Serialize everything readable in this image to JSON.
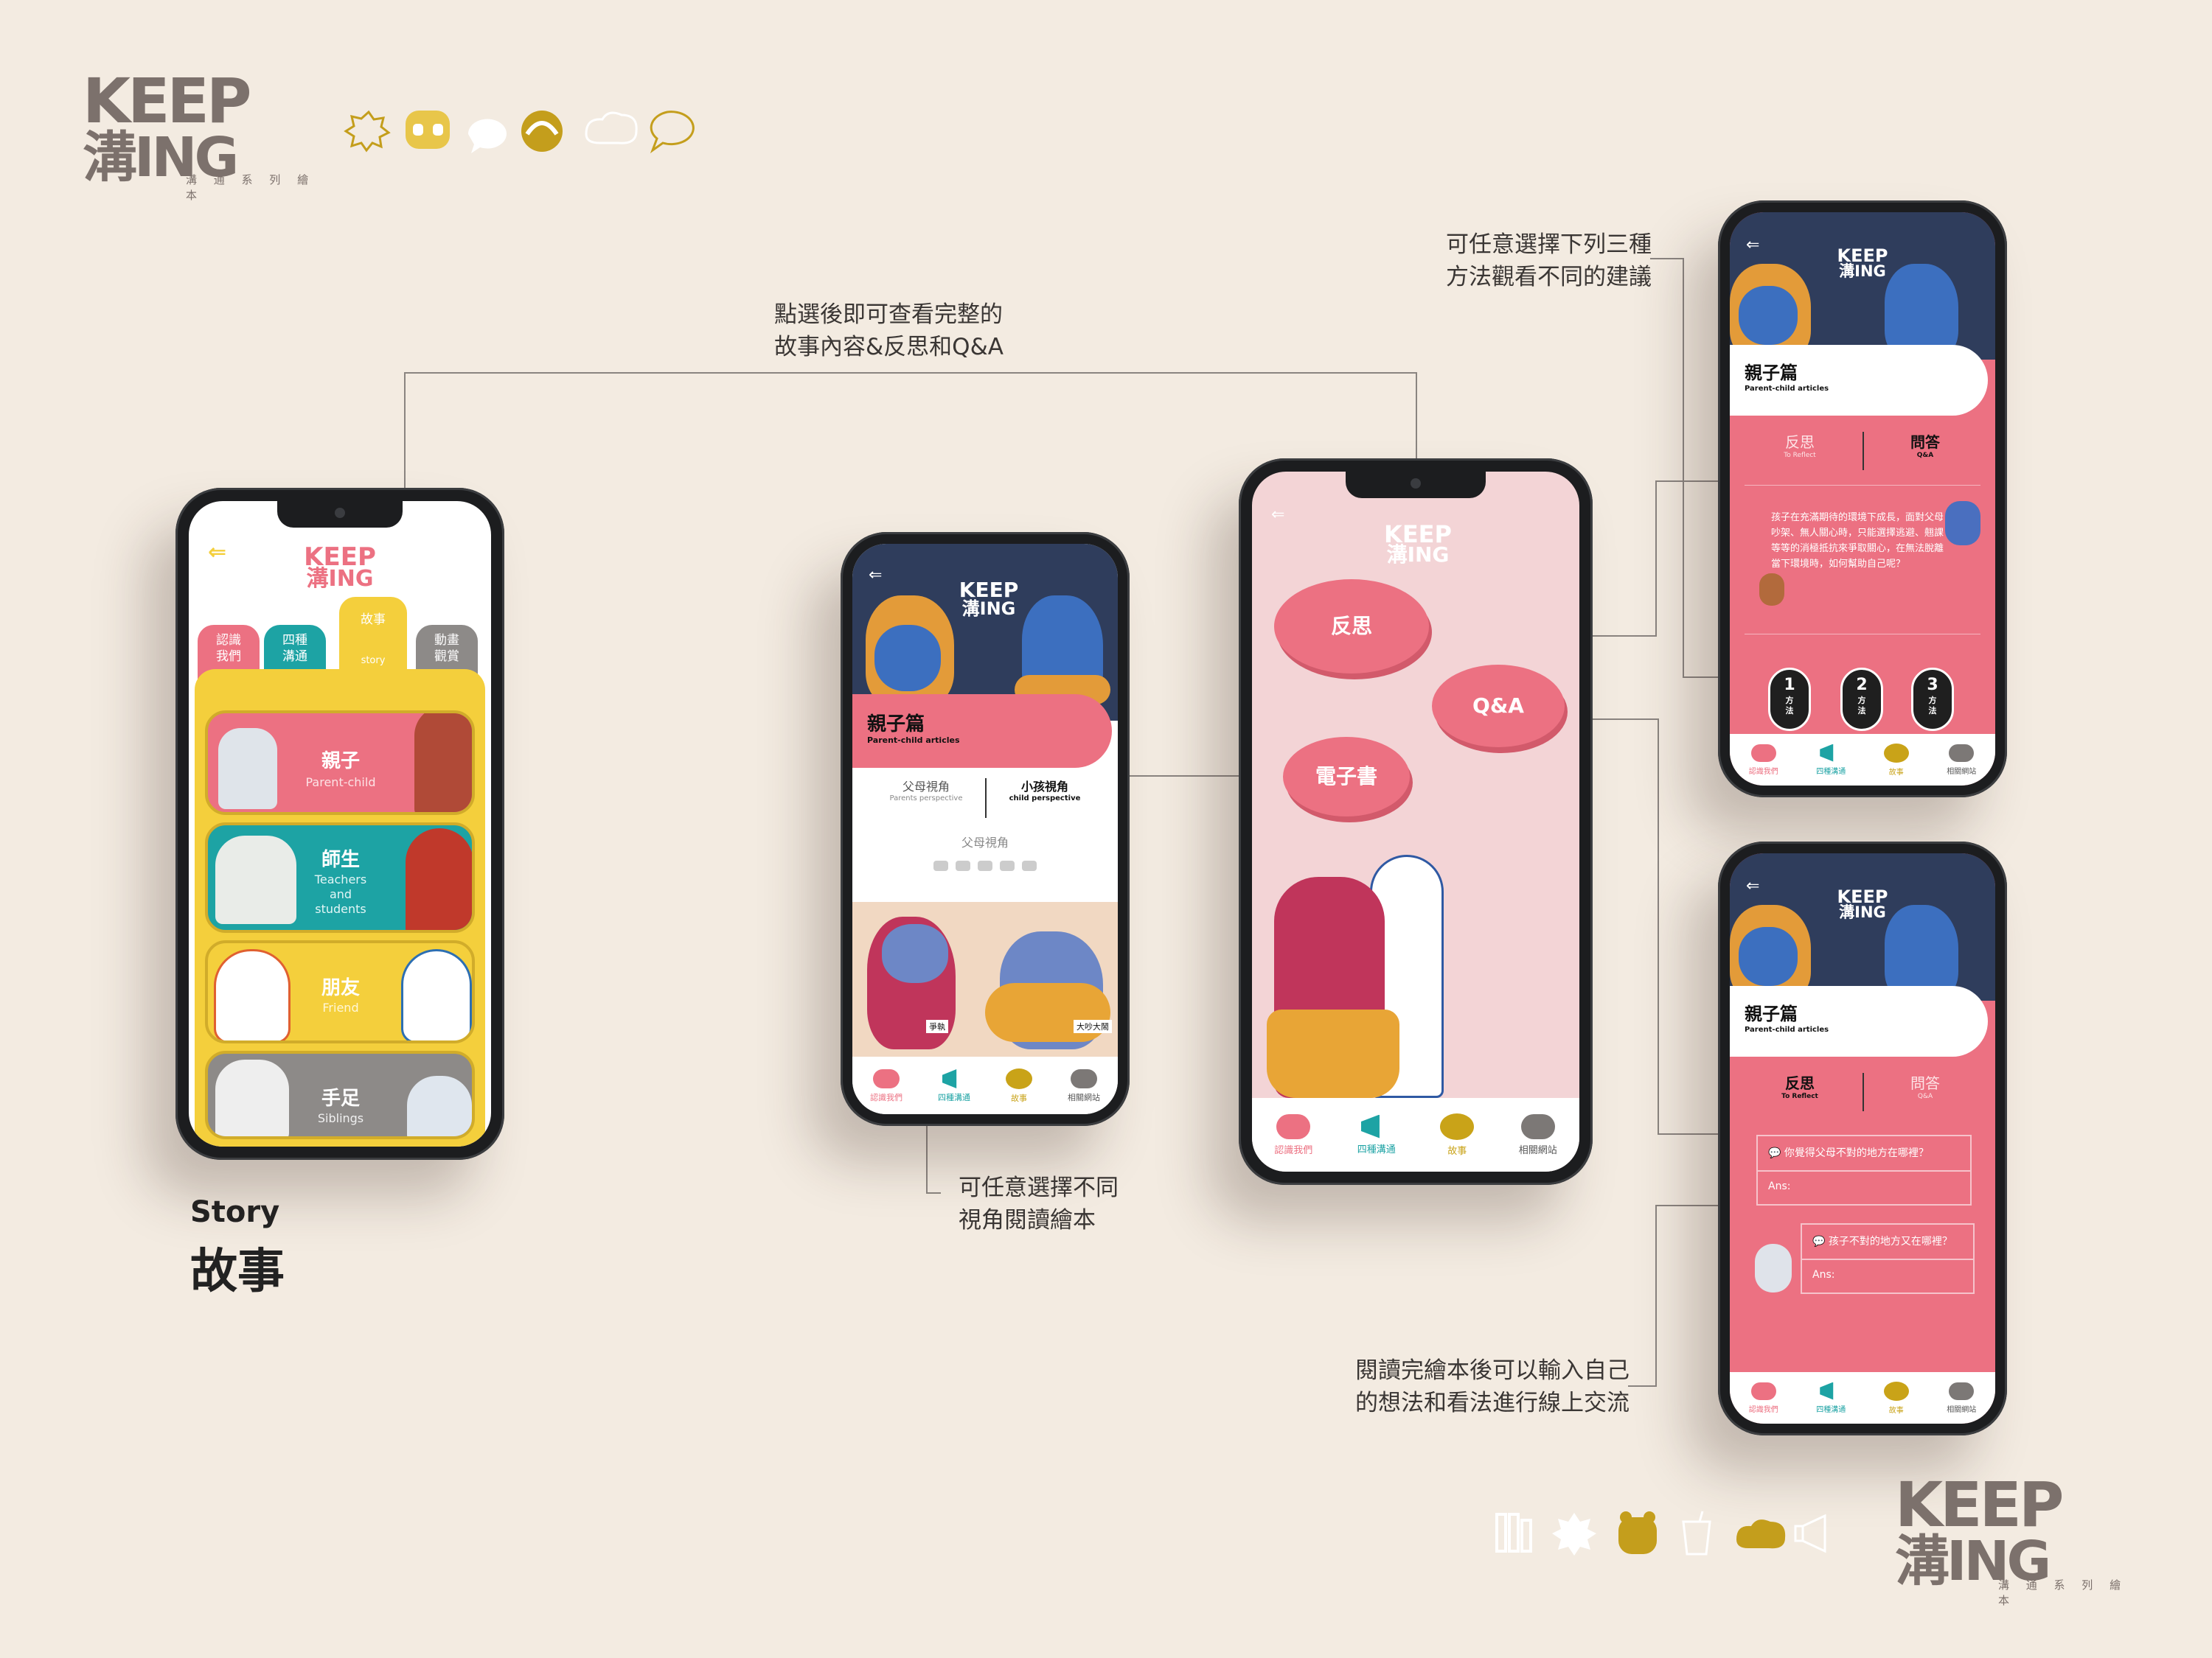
{
  "brand": {
    "logo_top": "KEEP",
    "logo_bottom": "溝ING",
    "subtitle": "溝 通 系 列 繪 本"
  },
  "colors": {
    "background": "#f3ebe1",
    "pink": "#ec7182",
    "teal": "#1da3a4",
    "yellow": "#f4cf3c",
    "gray": "#8d8a88",
    "navy": "#2f3d5c"
  },
  "top_icons": [
    "sun-burst-icon",
    "bear-face-icon",
    "speech-bubble-icon",
    "swirl-icon",
    "cloud-icon",
    "chat-bubble-icon"
  ],
  "bottom_icons": [
    "books-icon",
    "spiky-bubble-icon",
    "bear-icon",
    "cup-icon",
    "cloud-icon",
    "megaphone-icon"
  ],
  "section": {
    "title_en": "Story",
    "title_zh": "故事"
  },
  "annotations": {
    "top_center": [
      "點選後即可查看完整的",
      "故事內容&反思和Q&A"
    ],
    "top_right": [
      "可任意選擇下列三種",
      "方法觀看不同的建議"
    ],
    "mid_center": [
      "可任意選擇不同",
      "視角閱讀繪本"
    ],
    "bottom_right": [
      "閱讀完繪本後可以輸入自己",
      "的想法和看法進行線上交流"
    ]
  },
  "phone1": {
    "tabs": [
      {
        "label": "認識\n我們",
        "color": "#ec7182"
      },
      {
        "label": "四種\n溝通",
        "color": "#1da3a4"
      },
      {
        "label": "故事",
        "sub": "story",
        "color": "#f4cf3c"
      },
      {
        "label": "動畫\n觀賞",
        "color": "#8d8a88"
      }
    ],
    "cards": [
      {
        "zh": "親子",
        "en": "Parent-child",
        "color": "#ec7182"
      },
      {
        "zh": "師生",
        "en": "Teachers\nand\nstudents",
        "color": "#1da3a4"
      },
      {
        "zh": "朋友",
        "en": "Friend",
        "color": "#f4cf3c"
      },
      {
        "zh": "手足",
        "en": "Siblings",
        "color": "#8d8a88"
      }
    ]
  },
  "phone2": {
    "title_zh": "親子篇",
    "title_en": "Parent-child articles",
    "view_left_zh": "父母視角",
    "view_left_en": "Parents perspective",
    "view_right_zh": "小孩視角",
    "view_right_en": "child perspective",
    "current_view": "父母視角",
    "speech_labels": [
      "爭執",
      "大吵大鬧"
    ]
  },
  "phone3": {
    "bubbles": [
      "反思",
      "Q&A",
      "電子書"
    ]
  },
  "phone4": {
    "title_zh": "親子篇",
    "title_en": "Parent-child articles",
    "tab_left_zh": "反思",
    "tab_left_en": "To Reflect",
    "tab_right_zh": "問答",
    "tab_right_en": "Q&A",
    "body": "孩子在充滿期待的環境下成長，面對父母吵架、無人關心時，只能選擇逃避、翹課等等的消極抵抗來爭取關心，在無法脫離當下環境時，如何幫助自己呢？",
    "methods": [
      {
        "num": "1",
        "label": "方法"
      },
      {
        "num": "2",
        "label": "方法"
      },
      {
        "num": "3",
        "label": "方法"
      }
    ]
  },
  "phone5": {
    "title_zh": "親子篇",
    "title_en": "Parent-child articles",
    "tab_left_zh": "反思",
    "tab_left_en": "To Reflect",
    "tab_right_zh": "問答",
    "tab_right_en": "Q&A",
    "q1": "你覺得父母不對的地方在哪裡？",
    "a1": "Ans:",
    "q2": "孩子不對的地方又在哪裡？",
    "a2": "Ans:"
  },
  "nav": [
    {
      "label": "認識我們",
      "icon": "cloud-icon",
      "color": "#ec7182"
    },
    {
      "label": "四種溝通",
      "icon": "megaphone-icon",
      "color": "#1da3a4"
    },
    {
      "label": "故事",
      "icon": "speech-bubble-icon",
      "color": "#c9a318"
    },
    {
      "label": "相關網站",
      "icon": "cloud-icon",
      "color": "#7c7876"
    }
  ]
}
